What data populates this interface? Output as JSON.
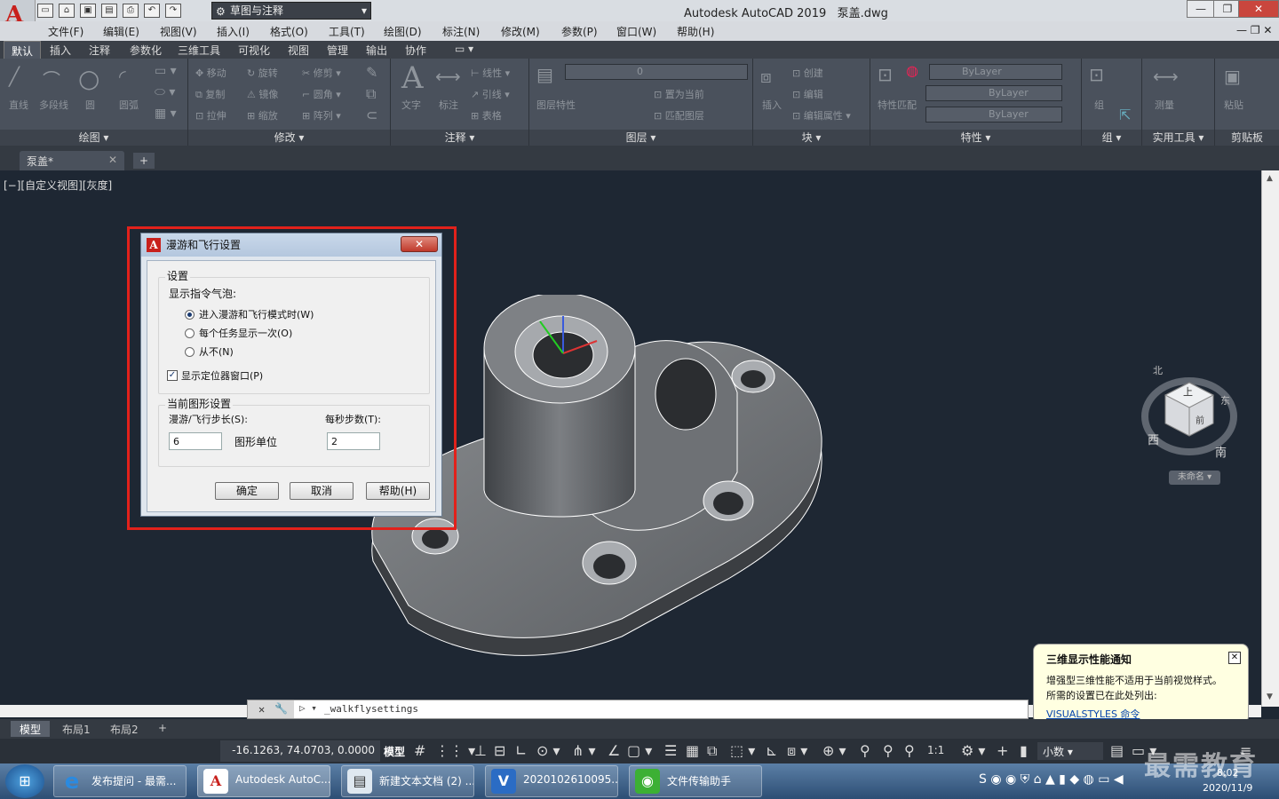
{
  "app": {
    "title": "Autodesk AutoCAD 2019",
    "file": "泵盖.dwg",
    "workspace": "草图与注释"
  },
  "menu": [
    "文件(F)",
    "编辑(E)",
    "视图(V)",
    "插入(I)",
    "格式(O)",
    "工具(T)",
    "绘图(D)",
    "标注(N)",
    "修改(M)",
    "参数(P)",
    "窗口(W)",
    "帮助(H)"
  ],
  "ribbon_tabs": [
    "默认",
    "插入",
    "注释",
    "参数化",
    "三维工具",
    "可视化",
    "视图",
    "管理",
    "输出",
    "协作"
  ],
  "ribbon": {
    "draw": {
      "title": "绘图",
      "items": [
        "直线",
        "多段线",
        "圆",
        "圆弧"
      ]
    },
    "modify": {
      "title": "修改",
      "items": [
        "移动",
        "旋转",
        "修剪",
        "复制",
        "镜像",
        "圆角",
        "拉伸",
        "缩放",
        "阵列"
      ]
    },
    "annotate": {
      "title": "注释",
      "items": [
        "文字",
        "标注",
        "线性",
        "引线",
        "表格"
      ]
    },
    "layers": {
      "title": "图层",
      "items": [
        "图层特性",
        "置为当前",
        "匹配图层"
      ],
      "current": "0"
    },
    "block": {
      "title": "块",
      "items": [
        "插入",
        "创建",
        "编辑",
        "编辑属性"
      ]
    },
    "properties": {
      "title": "特性",
      "items": [
        "特性匹配"
      ],
      "values": [
        "ByLayer",
        "ByLayer",
        "ByLayer"
      ]
    },
    "groups": {
      "title": "组",
      "items": [
        "组"
      ]
    },
    "utilities": {
      "title": "实用工具",
      "items": [
        "测量"
      ]
    },
    "clipboard": {
      "title": "剪贴板",
      "items": [
        "粘贴"
      ]
    }
  },
  "file_tab": {
    "label": "泵盖*"
  },
  "viewport_label": "[−][自定义视图][灰度]",
  "viewcube": {
    "top": "上",
    "west": "西",
    "south": "南",
    "north": "北",
    "east": "东",
    "face": "前",
    "ucs": "未命名"
  },
  "dialog": {
    "title": "漫游和飞行设置",
    "settings_label": "设置",
    "bubble_label": "显示指令气泡:",
    "options": [
      "进入漫游和飞行模式时(W)",
      "每个任务显示一次(O)",
      "从不(N)"
    ],
    "selected_option": 0,
    "show_locator": "显示定位器窗口(P)",
    "show_locator_checked": true,
    "current_settings_label": "当前图形设置",
    "step_label": "漫游/飞行步长(S):",
    "step_value": "6",
    "step_unit": "图形单位",
    "steps_per_sec_label": "每秒步数(T):",
    "steps_per_sec_value": "2",
    "buttons": [
      "确定",
      "取消",
      "帮助(H)"
    ]
  },
  "notification": {
    "title": "三维显示性能通知",
    "body_line1": "增强型三维性能不适用于当前视觉样式。",
    "body_line2": "所需的设置已在此处列出:",
    "link": "VISUALSTYLES 命令"
  },
  "command_line": {
    "text": "_walkflysettings"
  },
  "layout_tabs": [
    "模型",
    "布局1",
    "布局2"
  ],
  "status": {
    "coords": "-16.1263, 74.0703, 0.0000",
    "mode": "模型",
    "scale": "1:1",
    "units": "小数"
  },
  "taskbar": {
    "items": [
      "发布提问 - 最需...",
      "Autodesk AutoC...",
      "新建文本文档 (2) ...",
      "2020102610095...",
      "文件传输助手"
    ],
    "time": "8:02",
    "date": "2020/11/9"
  },
  "watermark": "最需教育"
}
